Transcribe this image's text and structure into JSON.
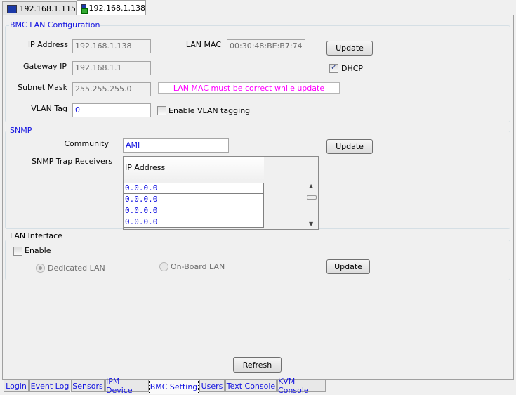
{
  "top_tabs": [
    {
      "label": "192.168.1.115",
      "icon": "computer-icon"
    },
    {
      "label": "192.168.1.138",
      "icon": "network-computer-icon",
      "selected": true
    }
  ],
  "bmc_lan": {
    "title": "BMC LAN Configuration",
    "ip_label": "IP Address",
    "ip_value": "192.168.1.138",
    "gateway_label": "Gateway IP",
    "gateway_value": "192.168.1.1",
    "subnet_label": "Subnet Mask",
    "subnet_value": "255.255.255.0",
    "vlan_label": "VLAN Tag",
    "vlan_value": "0",
    "mac_label": "LAN MAC",
    "mac_value": "00:30:48:BE:B7:74",
    "update_label": "Update",
    "dhcp_label": "DHCP",
    "dhcp_checked": true,
    "message": "LAN MAC must be correct while update",
    "vlan_enable_label": "Enable VLAN tagging",
    "vlan_enable_checked": false
  },
  "snmp": {
    "title": "SNMP",
    "community_label": "Community",
    "community_value": "AMI",
    "update_label": "Update",
    "trap_label": "SNMP Trap Receivers",
    "column_header": "IP Address",
    "receivers": [
      "0.0.0.0",
      "0.0.0.0",
      "0.0.0.0",
      "0.0.0.0"
    ]
  },
  "lan_interface": {
    "title": "LAN Interface",
    "enable_label": "Enable",
    "enable_checked": false,
    "dedicated_label": "Dedicated LAN",
    "onboard_label": "On-Board LAN",
    "selected": "Dedicated LAN",
    "update_label": "Update"
  },
  "refresh_label": "Refresh",
  "bottom_tabs": [
    "Login",
    "Event Log",
    "Sensors",
    "IPM Device",
    "BMC Setting",
    "Users",
    "Text Console",
    "KVM Console"
  ],
  "selected_bottom_tab": "BMC Setting"
}
